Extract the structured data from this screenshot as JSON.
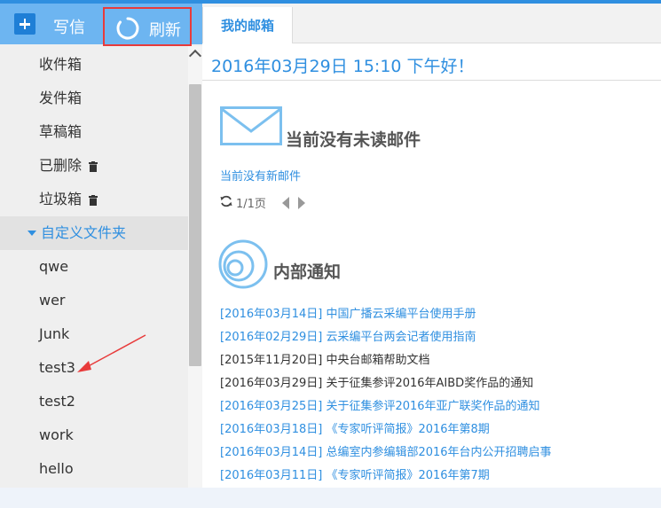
{
  "toolbar": {
    "write_label": "写信",
    "refresh_label": "刷新"
  },
  "folders": [
    {
      "label": "收件箱",
      "trash": false
    },
    {
      "label": "发件箱",
      "trash": false
    },
    {
      "label": "草稿箱",
      "trash": false
    },
    {
      "label": "已删除",
      "trash": true
    },
    {
      "label": "垃圾箱",
      "trash": true
    }
  ],
  "custom_folder": {
    "label": "自定义文件夹",
    "items": [
      "qwe",
      "wer",
      "Junk",
      "test3",
      "test2",
      "work",
      "hello"
    ]
  },
  "main": {
    "tab_label": "我的邮箱",
    "greeting": "2016年03月29日 15:10  下午好！",
    "unread_title": "当前没有未读邮件",
    "no_new_mail": "当前没有新邮件",
    "page_info": "1/1页",
    "notice_title": "内部通知",
    "notices": [
      {
        "date": "[2016年03月14日]",
        "title": "中国广播云采编平台使用手册",
        "color": "blue"
      },
      {
        "date": "[2016年02月29日]",
        "title": "云采编平台两会记者使用指南",
        "color": "blue"
      },
      {
        "date": "[2015年11月20日]",
        "title": "中央台邮箱帮助文档",
        "color": "dark"
      },
      {
        "date": "[2016年03月29日]",
        "title": "关于征集参评2016年AIBD奖作品的通知",
        "color": "dark"
      },
      {
        "date": "[2016年03月25日]",
        "title": "关于征集参评2016年亚广联奖作品的通知",
        "color": "blue"
      },
      {
        "date": "[2016年03月18日]",
        "title": "《专家听评简报》2016年第8期",
        "color": "blue"
      },
      {
        "date": "[2016年03月14日]",
        "title": "总编室内参编辑部2016年台内公开招聘启事",
        "color": "blue"
      },
      {
        "date": "[2016年03月11日]",
        "title": "《专家听评简报》2016年第7期",
        "color": "blue"
      }
    ]
  },
  "colors": {
    "accent": "#2f8fe0",
    "sidebar_header": "#6db5f1",
    "highlight_border": "#e83b3b",
    "annotation_arrow": "#e83b3b"
  }
}
